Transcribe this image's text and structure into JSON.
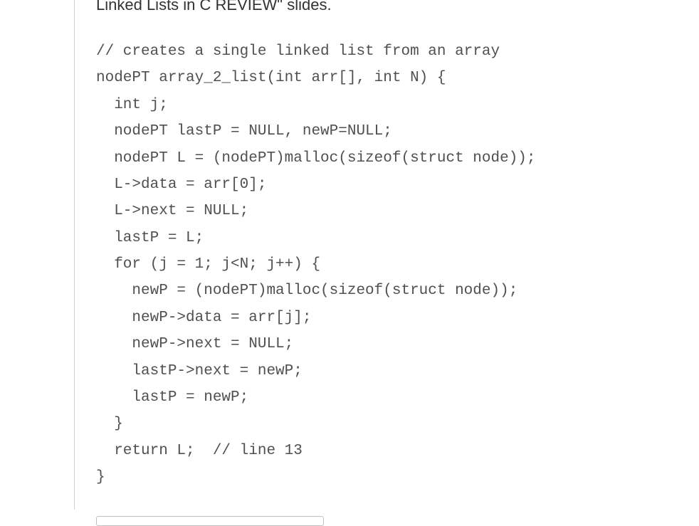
{
  "heading_fragment": "Linked Lists in C REVIEW\" slides.",
  "code": {
    "l1": "// creates a single linked list from an array",
    "l2": "nodePT array_2_list(int arr[], int N) {",
    "l3": "  int j;",
    "l4": "  nodePT lastP = NULL, newP=NULL;",
    "l5": "  nodePT L = (nodePT)malloc(sizeof(struct node));",
    "l6": "  L->data = arr[0];",
    "l7": "  L->next = NULL;",
    "l8": "  lastP = L;",
    "l9": "  for (j = 1; j<N; j++) {",
    "l10": "    newP = (nodePT)malloc(sizeof(struct node));",
    "l11": "    newP->data = arr[j];",
    "l12": "    newP->next = NULL;",
    "l13": "    lastP->next = newP;",
    "l14": "    lastP = newP;",
    "l15": "  }",
    "l16": "  return L;  // line 13",
    "l17": "}"
  }
}
